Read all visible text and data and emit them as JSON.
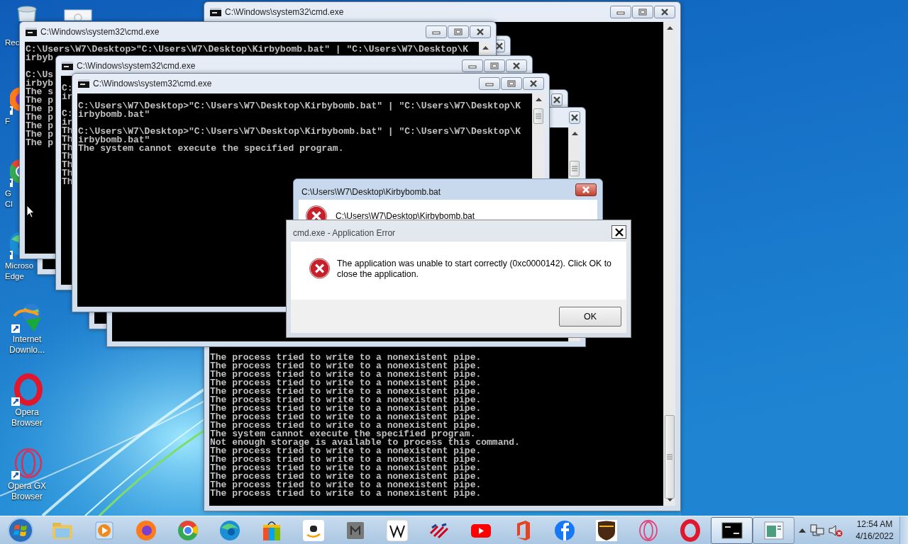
{
  "desktop_icons": [
    {
      "label_lines": [
        "Rec"
      ]
    },
    {
      "label_lines": [
        "F"
      ]
    },
    {
      "label_lines": [
        "G",
        "Cl"
      ]
    },
    {
      "label_lines": [
        "Microso",
        "Edge"
      ]
    },
    {
      "label_lines": [
        "Internet",
        "Downlo..."
      ]
    },
    {
      "label_lines": [
        "Opera",
        "Browser"
      ]
    },
    {
      "label_lines": [
        "Opera GX",
        "Browser"
      ]
    }
  ],
  "console_windows": [
    {
      "title": "C:\\Windows\\system32\\cmd.exe",
      "output": [
        [
          "The process tried to write to a nonexistent pipe.",
          "The process tried to write to a nonexistent pipe.",
          "The process tried to write to a nonexistent pipe.",
          "The process tried to write to a nonexistent pipe.",
          "The process tried to write to a nonexistent pipe.",
          "The process tried to write to a nonexistent pipe.",
          "The process tried to write to a nonexistent pipe.",
          "The process tried to write to a nonexistent pipe.",
          "The process tried to write to a nonexistent pipe.",
          "The system cannot execute the specified program.",
          "Not enough storage is available to process this command.",
          "The process tried to write to a nonexistent pipe.",
          "The process tried to write to a nonexistent pipe.",
          "The process tried to write to a nonexistent pipe.",
          "The process tried to write to a nonexistent pipe.",
          "The process tried to write to a nonexistent pipe.",
          "The process tried to write to a nonexistent pipe."
        ]
      ]
    },
    {
      "title": "C:\\Windows\\system32\\cmd.exe",
      "output": [
        [
          "C:\\Users\\W7\\Desktop>\"C:\\Users\\W7\\Desktop\\Kirbybomb.bat\" | \"C:\\Users\\W7\\Desktop\\K",
          "irbyb"
        ],
        [
          "C:\\Us",
          "irbyb",
          "The s",
          "The p",
          "The p",
          "The p",
          "The p",
          "The p",
          "The p"
        ]
      ]
    },
    {
      "title": "C:\\Windows\\system32\\cmd.exe",
      "output": [
        [
          "C:",
          "ir"
        ],
        [
          "C:",
          "ir",
          "Th",
          "Th",
          "Th",
          "Th",
          "Th",
          "Th",
          "Th"
        ]
      ]
    },
    {
      "title": "C:\\Windows\\system32\\cmd.exe",
      "output": [
        [
          "C:\\Users\\W7\\Desktop>\"C:\\Users\\W7\\Desktop\\Kirbybomb.bat\" | \"C:\\Users\\W7\\Desktop\\K",
          "irbybomb.bat\""
        ],
        [
          "C:\\Users\\W7\\Desktop>\"C:\\Users\\W7\\Desktop\\Kirbybomb.bat\" | \"C:\\Users\\W7\\Desktop\\K",
          "irbybomb.bat\"",
          "The system cannot execute the specified program."
        ]
      ]
    }
  ],
  "dialogs": [
    {
      "title": "C:\\Users\\W7\\Desktop\\Kirbybomb.bat",
      "message": "C:\\Users\\W7\\Desktop\\Kirbybomb.bat"
    },
    {
      "title": "cmd.exe - Application Error",
      "message": "The application was unable to start correctly (0xc0000142). Click OK to close the application.",
      "buttons": [
        "OK"
      ]
    }
  ],
  "taskbar": {
    "items": [
      {
        "running": false,
        "selected": false
      },
      {
        "running": false,
        "selected": false
      },
      {
        "running": false,
        "selected": false
      },
      {
        "running": false,
        "selected": false
      },
      {
        "running": false,
        "selected": false
      },
      {
        "running": false,
        "selected": false
      },
      {
        "running": false,
        "selected": false
      },
      {
        "running": false,
        "selected": false
      },
      {
        "running": false,
        "selected": false
      },
      {
        "running": false,
        "selected": false
      },
      {
        "running": false,
        "selected": false
      },
      {
        "running": false,
        "selected": false
      },
      {
        "running": false,
        "selected": false
      },
      {
        "running": false,
        "selected": false
      },
      {
        "running": false,
        "selected": false
      },
      {
        "running": false,
        "selected": false
      },
      {
        "running": true,
        "selected": true
      },
      {
        "running": true,
        "selected": false
      }
    ],
    "clock": {
      "time": "12:54 AM",
      "date": "4/16/2022"
    }
  }
}
